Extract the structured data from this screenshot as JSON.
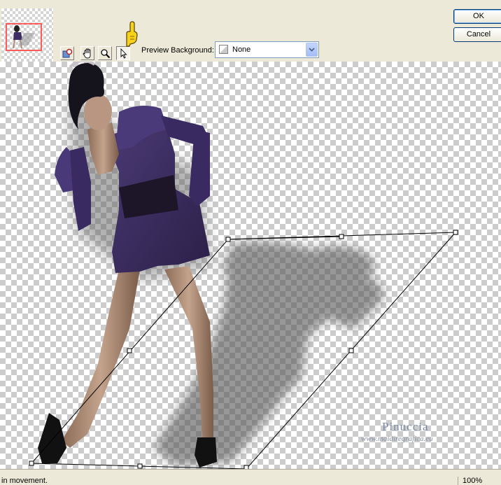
{
  "toolbar": {
    "preview_background_label": "Preview Background:",
    "preview_background_value": "None",
    "tools": [
      {
        "name": "pan-zoom-icon",
        "active": false
      },
      {
        "name": "hand-icon",
        "active": false
      },
      {
        "name": "zoom-icon",
        "active": false
      },
      {
        "name": "arrow-pointer-icon",
        "active": true
      }
    ],
    "pointer_hint_icon": "yellow-pointing-hand-icon"
  },
  "dialog_buttons": {
    "ok_label": "OK",
    "cancel_label": "Cancel"
  },
  "canvas": {
    "watermark_name": "Pinuccia",
    "watermark_url": "www.maidiregrafica.eu"
  },
  "statusbar": {
    "message": "in movement.",
    "zoom": "100%"
  },
  "colors": {
    "dialog_bg": "#ece9d8",
    "dress": "#3d2d62",
    "selection_rect": "#ff5a5a"
  }
}
